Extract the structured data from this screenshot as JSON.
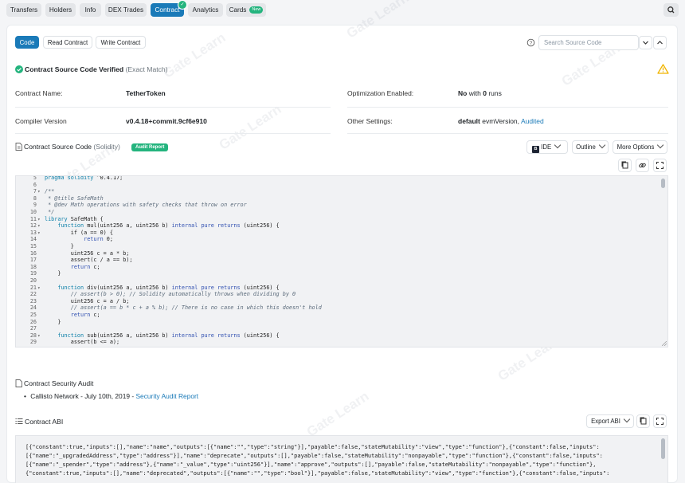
{
  "nav": {
    "tabs": [
      {
        "label": "Transfers"
      },
      {
        "label": "Holders"
      },
      {
        "label": "Info"
      },
      {
        "label": "DEX Trades"
      },
      {
        "label": "Contract",
        "active": true
      },
      {
        "label": "Analytics"
      },
      {
        "label": "Cards",
        "badge": "New"
      }
    ]
  },
  "subtabs": {
    "code": "Code",
    "read": "Read Contract",
    "write": "Write Contract"
  },
  "search": {
    "placeholder": "Search Source Code"
  },
  "verified": {
    "title": "Contract Source Code Verified",
    "note": "(Exact Match)"
  },
  "info": {
    "contract_name_label": "Contract Name:",
    "contract_name": "TetherToken",
    "optimization_label": "Optimization Enabled:",
    "optimization_value": "No",
    "optimization_with": "with",
    "optimization_runs": "0",
    "optimization_runs_label": "runs",
    "compiler_label": "Compiler Version",
    "compiler_value": "v0.4.18+commit.9cf6e910",
    "settings_label": "Other Settings:",
    "settings_value": "default",
    "settings_evm": "evmVersion,",
    "settings_link": "Audited"
  },
  "source": {
    "title": "Contract Source Code",
    "lang": "(Solidity)",
    "audit_badge": "Audit Report",
    "ide_label": "IDE",
    "outline_label": "Outline",
    "more_label": "More Options"
  },
  "code_lines": [
    {
      "n": "5",
      "fold": "",
      "t": "pragma solidity ^0.4.17;"
    },
    {
      "n": "6",
      "fold": "",
      "t": ""
    },
    {
      "n": "7",
      "fold": "▾",
      "t": "/**"
    },
    {
      "n": "8",
      "fold": "",
      "t": " * @title SafeMath"
    },
    {
      "n": "9",
      "fold": "",
      "t": " * @dev Math operations with safety checks that throw on error"
    },
    {
      "n": "10",
      "fold": "",
      "t": " */"
    },
    {
      "n": "11",
      "fold": "▾",
      "t": "library SafeMath {"
    },
    {
      "n": "12",
      "fold": "▾",
      "t": "    function mul(uint256 a, uint256 b) internal pure returns (uint256) {"
    },
    {
      "n": "13",
      "fold": "▾",
      "t": "        if (a == 0) {"
    },
    {
      "n": "14",
      "fold": "",
      "t": "            return 0;"
    },
    {
      "n": "15",
      "fold": "",
      "t": "        }"
    },
    {
      "n": "16",
      "fold": "",
      "t": "        uint256 c = a * b;"
    },
    {
      "n": "17",
      "fold": "",
      "t": "        assert(c / a == b);"
    },
    {
      "n": "18",
      "fold": "",
      "t": "        return c;"
    },
    {
      "n": "19",
      "fold": "",
      "t": "    }"
    },
    {
      "n": "20",
      "fold": "",
      "t": ""
    },
    {
      "n": "21",
      "fold": "▾",
      "t": "    function div(uint256 a, uint256 b) internal pure returns (uint256) {"
    },
    {
      "n": "22",
      "fold": "",
      "t": "        // assert(b > 0); // Solidity automatically throws when dividing by 0"
    },
    {
      "n": "23",
      "fold": "",
      "t": "        uint256 c = a / b;"
    },
    {
      "n": "24",
      "fold": "",
      "t": "        // assert(a == b * c + a % b); // There is no case in which this doesn't hold"
    },
    {
      "n": "25",
      "fold": "",
      "t": "        return c;"
    },
    {
      "n": "26",
      "fold": "",
      "t": "    }"
    },
    {
      "n": "27",
      "fold": "",
      "t": ""
    },
    {
      "n": "28",
      "fold": "▾",
      "t": "    function sub(uint256 a, uint256 b) internal pure returns (uint256) {"
    },
    {
      "n": "29",
      "fold": "",
      "t": "        assert(b <= a);"
    }
  ],
  "audit": {
    "title": "Contract Security Audit",
    "item_text": "Callisto Network - July 10th, 2019 -",
    "item_link": "Security Audit Report"
  },
  "abi": {
    "title": "Contract ABI",
    "export_label": "Export ABI",
    "lines": [
      "[{\"constant\":true,\"inputs\":[],\"name\":\"name\",\"outputs\":[{\"name\":\"\",\"type\":\"string\"}],\"payable\":false,\"stateMutability\":\"view\",\"type\":\"function\"},{\"constant\":false,\"inputs\":",
      "[{\"name\":\"_upgradedAddress\",\"type\":\"address\"}],\"name\":\"deprecate\",\"outputs\":[],\"payable\":false,\"stateMutability\":\"nonpayable\",\"type\":\"function\"},{\"constant\":false,\"inputs\":",
      "[{\"name\":\"_spender\",\"type\":\"address\"},{\"name\":\"_value\",\"type\":\"uint256\"}],\"name\":\"approve\",\"outputs\":[],\"payable\":false,\"stateMutability\":\"nonpayable\",\"type\":\"function\"},",
      "{\"constant\":true,\"inputs\":[],\"name\":\"deprecated\",\"outputs\":[{\"name\":\"\",\"type\":\"bool\"}],\"payable\":false,\"stateMutability\":\"view\",\"type\":\"function\"},{\"constant\":false,\"inputs\":"
    ]
  },
  "watermark": "Gate Learn",
  "colors": {
    "primary": "#1a7ab8",
    "success": "#24b47e",
    "warning": "#f0b400",
    "link": "#1a7ab8"
  }
}
